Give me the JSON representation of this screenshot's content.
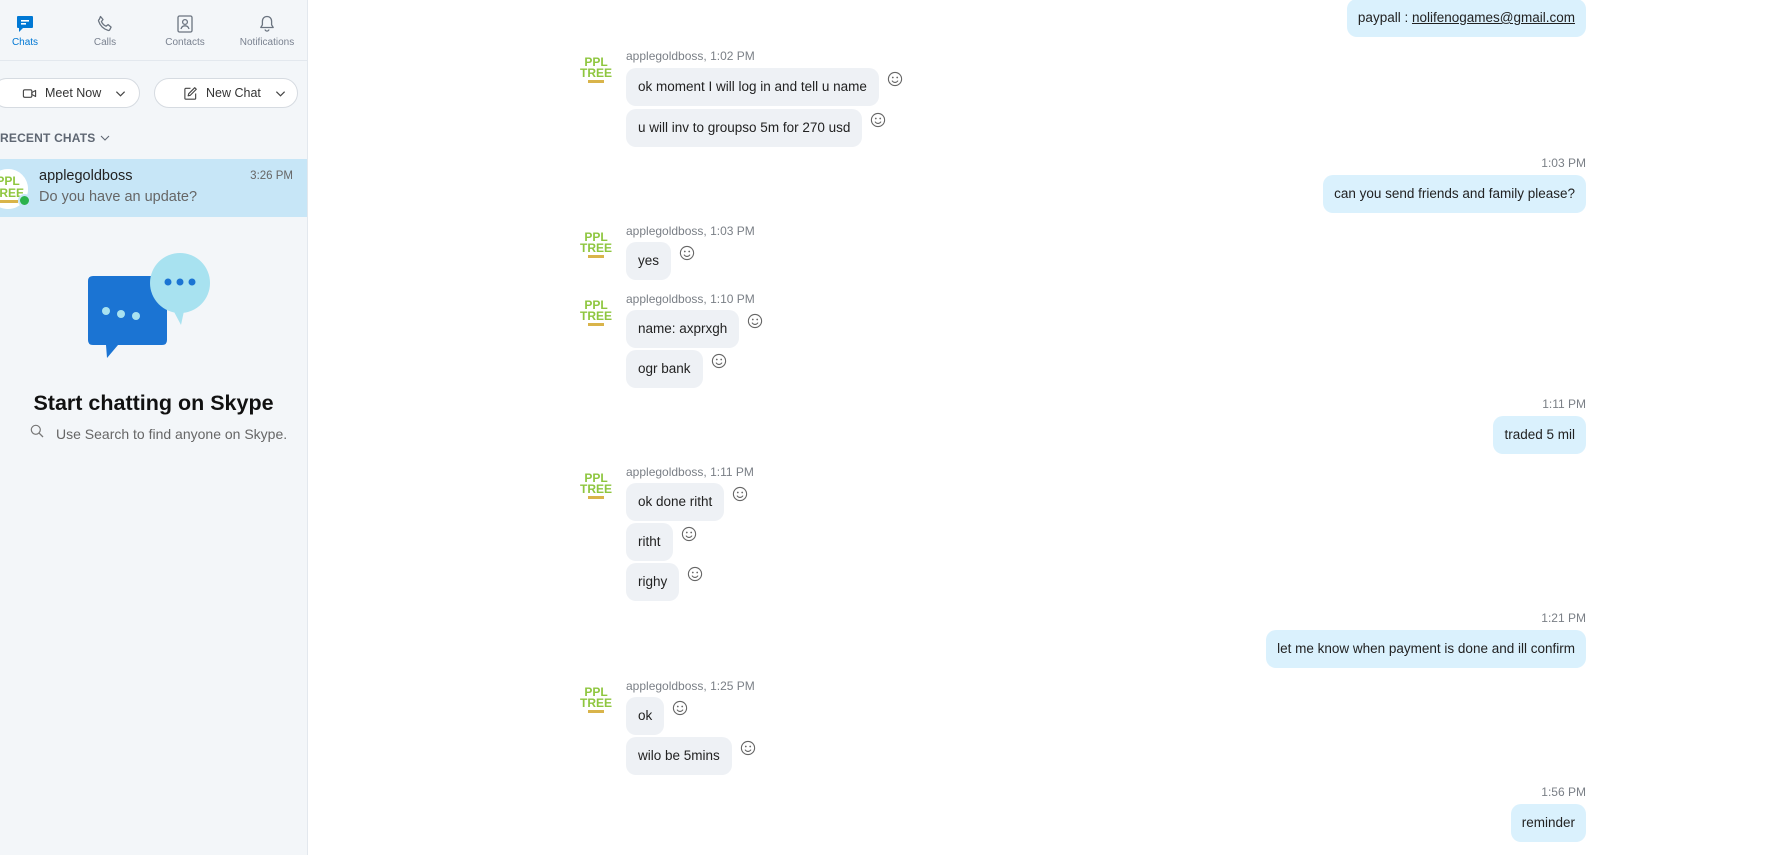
{
  "nav": {
    "chats": "Chats",
    "calls": "Calls",
    "contacts": "Contacts",
    "notifications": "Notifications"
  },
  "actions": {
    "meet_now": "Meet Now",
    "new_chat": "New Chat"
  },
  "recent_label": "RECENT CHATS",
  "recent_chats": [
    {
      "name": "applegoldboss",
      "preview": "Do you have an update?",
      "time": "3:26 PM"
    }
  ],
  "empty_state": {
    "title": "Start chatting on Skype",
    "hint": "Use Search to find anyone on Skype."
  },
  "avatar_text": {
    "line1": "PPL",
    "line2": "TREE"
  },
  "colors": {
    "accent": "#0078d4",
    "selected_chat": "#c7e6f7",
    "outgoing_bubble": "#daf1fd",
    "incoming_bubble": "#eef1f5",
    "presence": "#2bb24c"
  },
  "messages": [
    {
      "dir": "out",
      "prefix": "paypall : ",
      "link": "nolifenogames@gmail.com"
    },
    {
      "dir": "in",
      "meta": "applegoldboss, 1:02 PM",
      "lines": [
        "ok moment I will log in and tell u name",
        "u will inv to groupso 5m for 270 usd"
      ]
    },
    {
      "dir": "out",
      "time": "1:03 PM",
      "text": "can you send friends and family please?"
    },
    {
      "dir": "in",
      "meta": "applegoldboss, 1:03 PM",
      "lines": [
        "yes"
      ]
    },
    {
      "dir": "in",
      "meta": "applegoldboss, 1:10 PM",
      "lines": [
        "name: axprxgh",
        "ogr bank"
      ]
    },
    {
      "dir": "out",
      "time": "1:11 PM",
      "text": "traded 5 mil"
    },
    {
      "dir": "in",
      "meta": "applegoldboss, 1:11 PM",
      "lines": [
        "ok done ritht",
        "ritht",
        "righy"
      ]
    },
    {
      "dir": "out",
      "time": "1:21 PM",
      "text": "let me know when payment is done and ill confirm"
    },
    {
      "dir": "in",
      "meta": "applegoldboss, 1:25 PM",
      "lines": [
        "ok",
        "wilo be 5mins"
      ]
    },
    {
      "dir": "out",
      "time": "1:56 PM",
      "text": "reminder"
    }
  ]
}
